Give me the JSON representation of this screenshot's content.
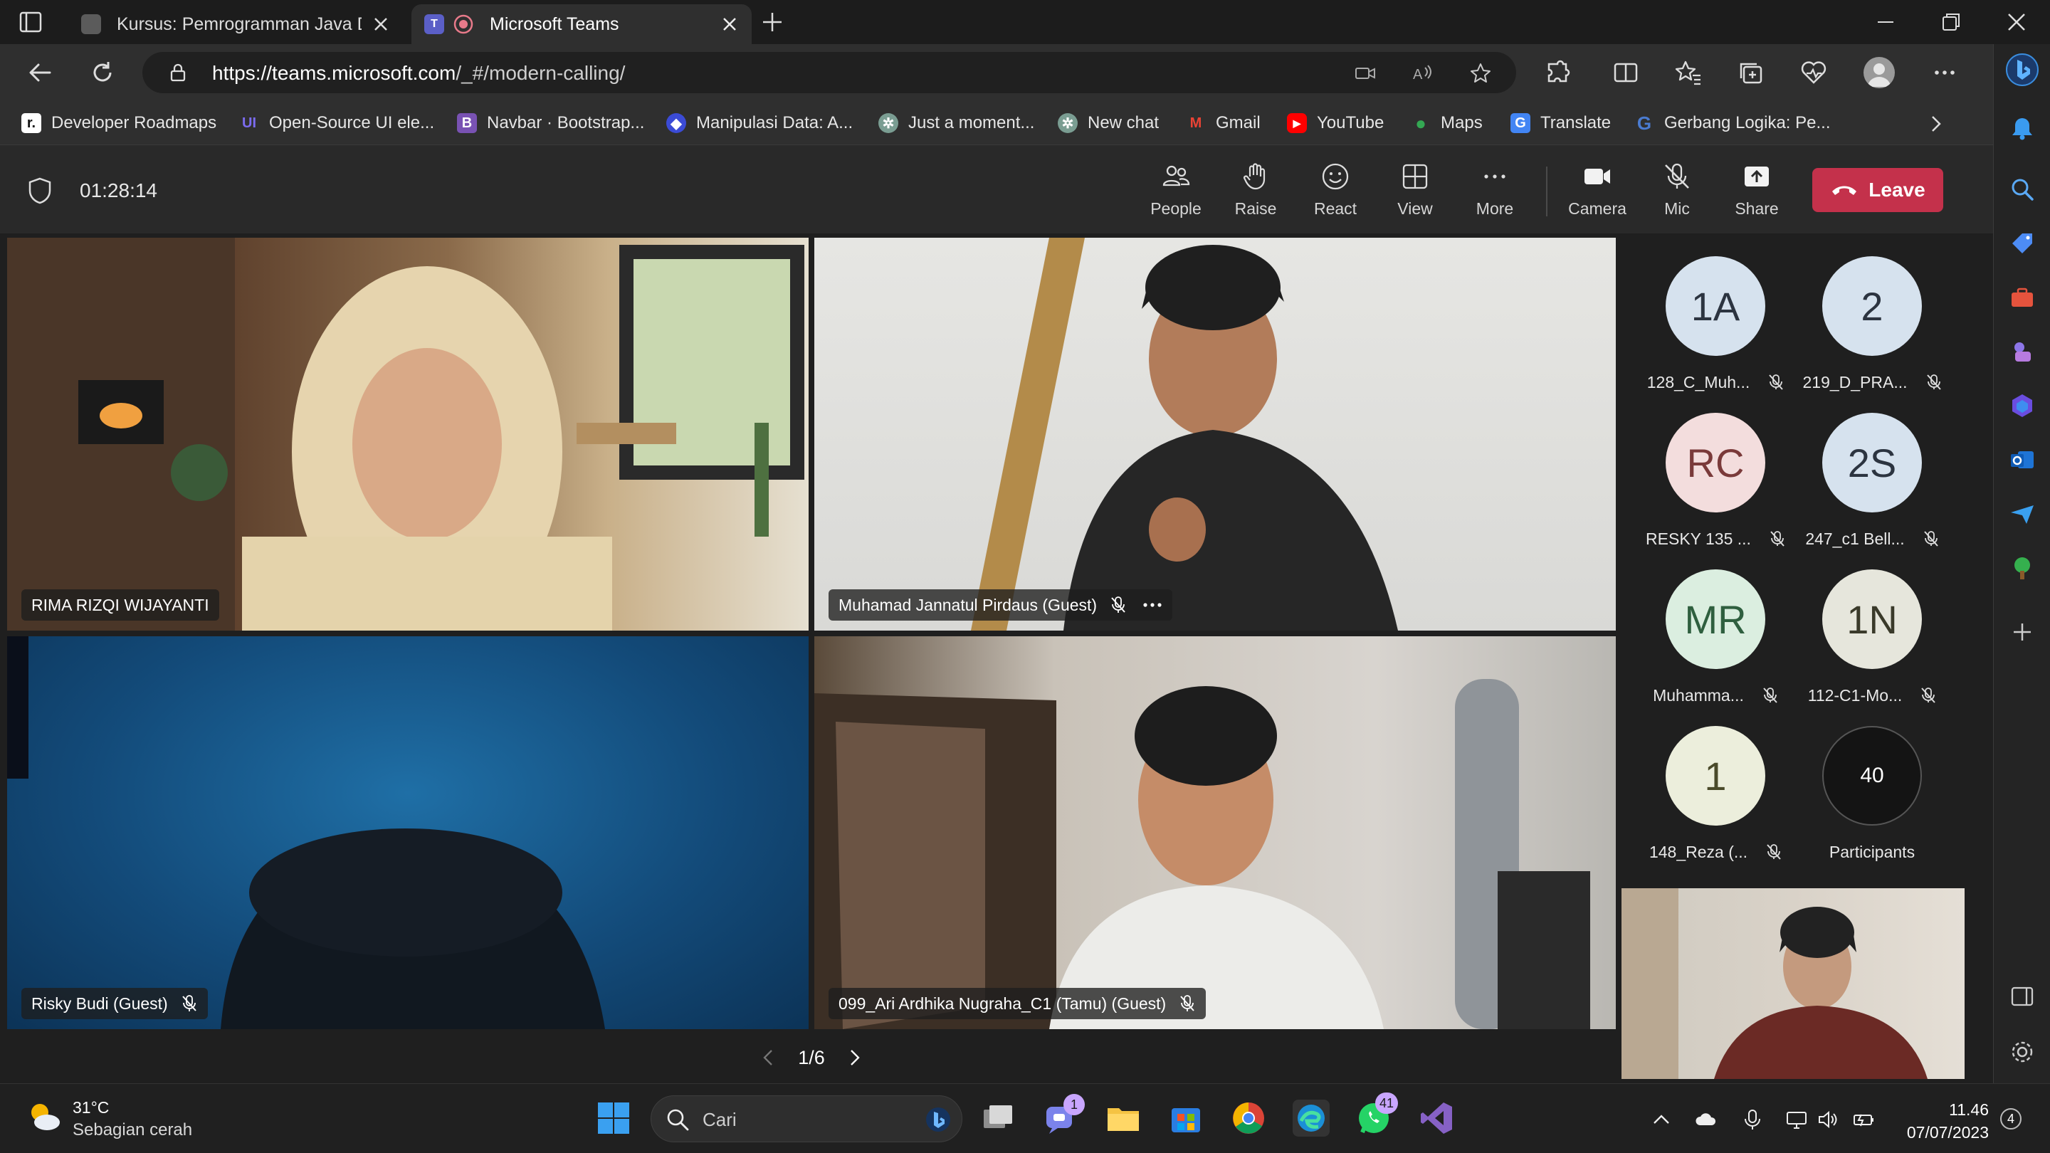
{
  "browser": {
    "tabs": [
      {
        "label": "Kursus: Pemrogramman Java Das",
        "active": false
      },
      {
        "label": "Microsoft Teams",
        "active": true
      }
    ],
    "url": {
      "domain": "https://teams.microsoft.com",
      "path": "/_#/modern-calling/"
    },
    "favorites": [
      "Developer Roadmaps",
      "Open-Source UI ele...",
      "Navbar · Bootstrap...",
      "Manipulasi Data: A...",
      "Just a moment...",
      "New chat",
      "Gmail",
      "YouTube",
      "Maps",
      "Translate",
      "Gerbang Logika: Pe..."
    ]
  },
  "meeting": {
    "timer": "01:28:14",
    "controls": {
      "people": "People",
      "raise": "Raise",
      "react": "React",
      "view": "View",
      "more": "More",
      "camera": "Camera",
      "mic": "Mic",
      "share": "Share",
      "leave": "Leave"
    },
    "tiles": [
      {
        "name": "RIMA RIZQI WIJAYANTI"
      },
      {
        "name": "Muhamad Jannatul Pirdaus (Guest)"
      },
      {
        "name": "Risky Budi (Guest)"
      },
      {
        "name": "099_Ari Ardhika Nugraha_C1 (Tamu) (Guest)"
      }
    ],
    "pagination": "1/6",
    "participants": [
      {
        "initials": "1A",
        "name": "128_C_Muh...",
        "color": "#d6e2ee"
      },
      {
        "initials": "2",
        "name": "219_D_PRA...",
        "color": "#d6e2ee"
      },
      {
        "initials": "RC",
        "name": "RESKY 135 ...",
        "color": "#f3dddd"
      },
      {
        "initials": "2S",
        "name": "247_c1 Bell...",
        "color": "#d6e2ee"
      },
      {
        "initials": "MR",
        "name": "Muhamma...",
        "color": "#dbeee0"
      },
      {
        "initials": "1N",
        "name": "112-C1-Mo...",
        "color": "#e6e6dc"
      },
      {
        "initials": "1",
        "name": "148_Reza (...",
        "color": "#eceedc"
      }
    ],
    "participant_count": {
      "value": "40",
      "label": "Participants"
    }
  },
  "taskbar": {
    "weather": {
      "temp": "31°C",
      "desc": "Sebagian cerah"
    },
    "search_label": "Cari",
    "badges": {
      "chat": "1",
      "whatsapp": "41"
    },
    "clock": {
      "time": "11.46",
      "date": "07/07/2023"
    },
    "notifications": "4"
  }
}
